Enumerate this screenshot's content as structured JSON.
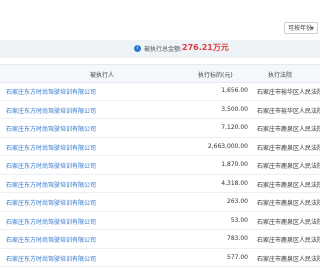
{
  "filter": {
    "label": "可按年份"
  },
  "summary": {
    "label": "被执行总金额:",
    "amount": "276.21万元"
  },
  "table": {
    "headers": [
      "被执行人",
      "执行标的(元)",
      "执行法院"
    ],
    "rows": [
      {
        "name": "石家庄东方时尚驾驶培训有限公司",
        "amount": "1,656.00",
        "court": "石家庄市裕华区人民法院"
      },
      {
        "name": "石家庄东方时尚驾驶培训有限公司",
        "amount": "3,500.00",
        "court": "石家庄市裕华区人民法院"
      },
      {
        "name": "石家庄东方时尚驾驶培训有限公司",
        "amount": "7,120.00",
        "court": "石家庄市鹿泉区人民法院"
      },
      {
        "name": "石家庄东方时尚驾驶培训有限公司",
        "amount": "2,663,000.00",
        "court": "石家庄市鹿泉区人民法院"
      },
      {
        "name": "石家庄东方时尚驾驶培训有限公司",
        "amount": "1,870.00",
        "court": "石家庄市鹿泉区人民法院"
      },
      {
        "name": "石家庄东方时尚驾驶培训有限公司",
        "amount": "4,318.00",
        "court": "石家庄市鹿泉区人民法院"
      },
      {
        "name": "石家庄东方时尚驾驶培训有限公司",
        "amount": "263.00",
        "court": "石家庄市鹿泉区人民法院"
      },
      {
        "name": "石家庄东方时尚驾驶培训有限公司",
        "amount": "53.00",
        "court": "石家庄市鹿泉区人民法院"
      },
      {
        "name": "石家庄东方时尚驾驶培训有限公司",
        "amount": "783.00",
        "court": "石家庄市鹿泉区人民法院"
      },
      {
        "name": "石家庄东方时尚驾驶培训有限公司",
        "amount": "577.00",
        "court": "石家庄市鹿泉区人民法院"
      }
    ]
  }
}
